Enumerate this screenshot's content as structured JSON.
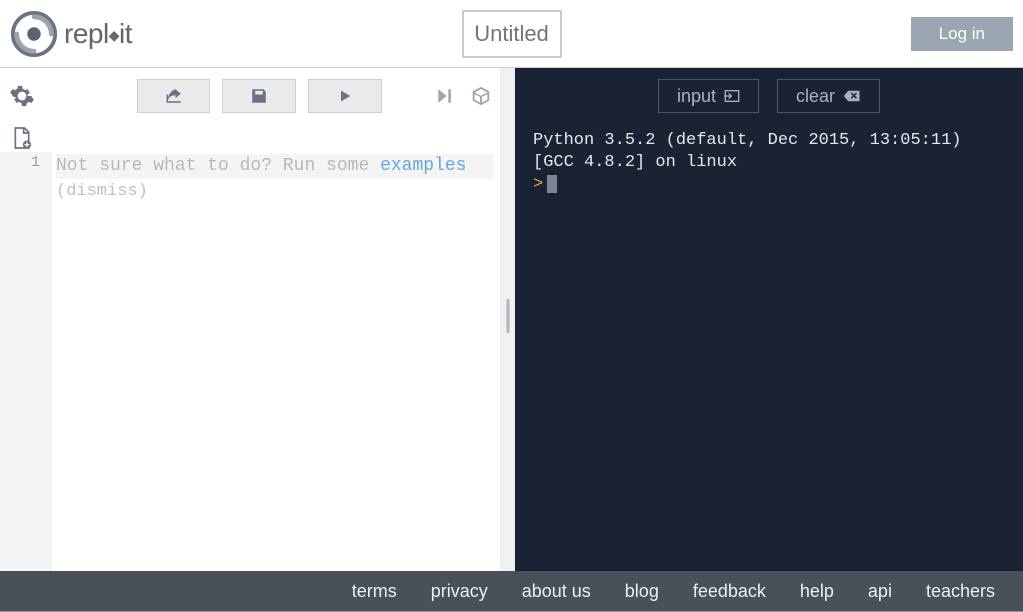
{
  "header": {
    "brand": "repl",
    "brand_suffix": "it",
    "title_placeholder": "Untitled",
    "login_label": "Log in"
  },
  "editor": {
    "line_numbers": [
      "1"
    ],
    "hint_prefix": "Not sure what to do? Run some ",
    "hint_link": "examples",
    "dismiss_label": "(dismiss)"
  },
  "console": {
    "input_label": "input",
    "clear_label": "clear",
    "output_line1": "Python 3.5.2 (default, Dec 2015, 13:05:11)",
    "output_line2": "[GCC 4.8.2] on linux",
    "prompt": ">"
  },
  "footer": {
    "links": [
      "terms",
      "privacy",
      "about us",
      "blog",
      "feedback",
      "help",
      "api",
      "teachers"
    ]
  }
}
